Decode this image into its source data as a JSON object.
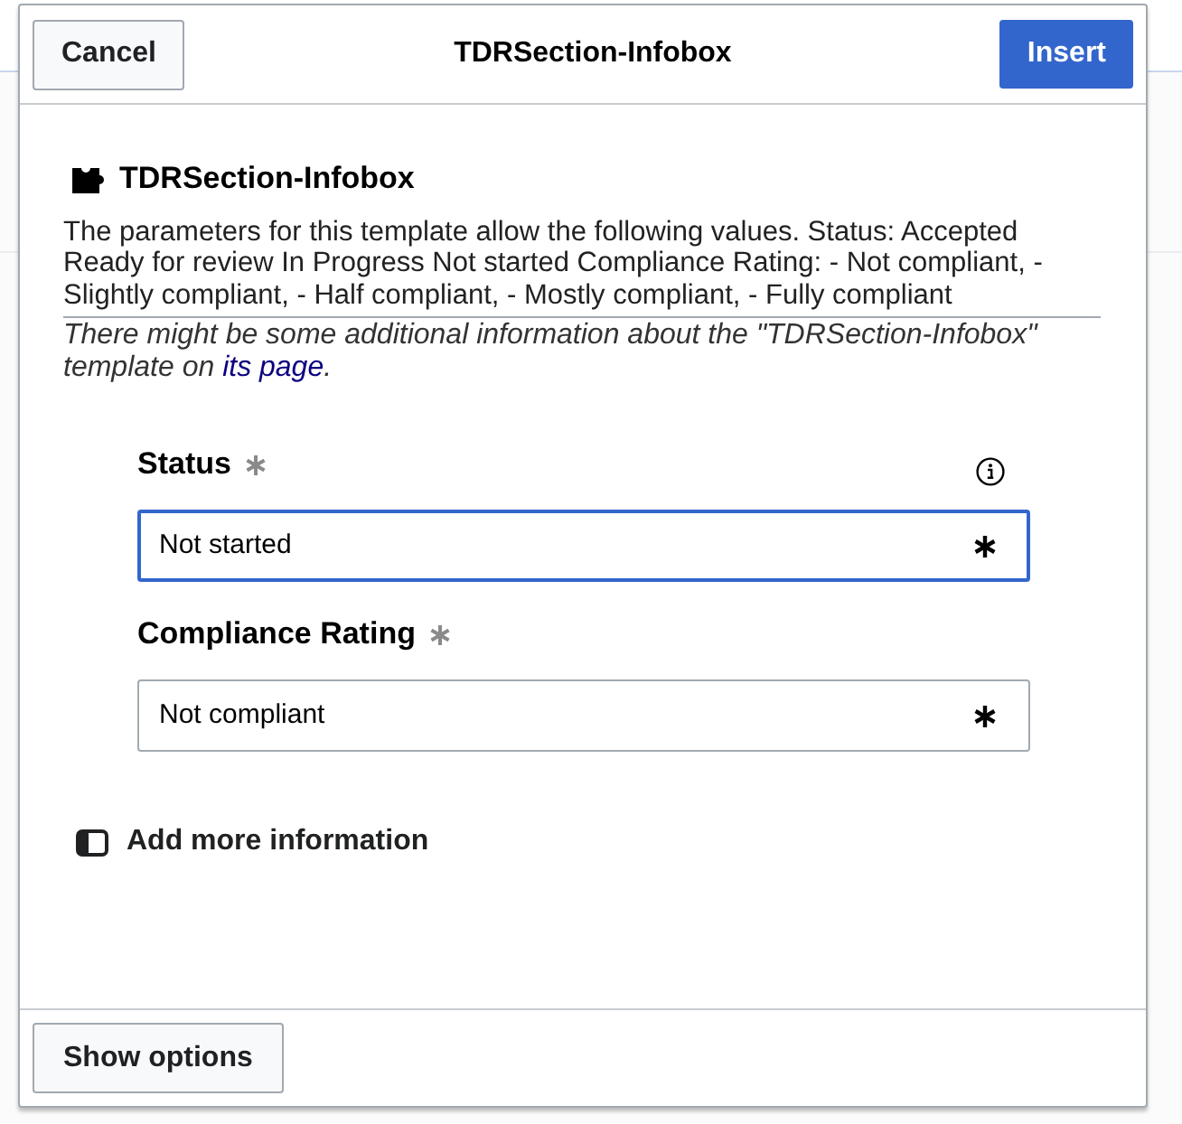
{
  "dialog": {
    "cancel_button": "Cancel",
    "title": "TDRSection-Infobox",
    "insert_button": "Insert"
  },
  "template": {
    "name": "TDRSection-Infobox",
    "description": "The parameters for this template allow the following values. Status: Accepted Ready for review In Progress Not started Compliance Rating: - Not compliant, - Slightly compliant, - Half compliant, - Mostly compliant, - Fully compliant",
    "note": "There might be some additional information about the \"TDRSection-Infobox\" template on ",
    "note_link": "its page",
    "note_end": "."
  },
  "parameters": [
    {
      "label": "Status",
      "required": true,
      "info": true,
      "value": "Not started",
      "focused": true
    },
    {
      "label": "Compliance Rating",
      "required": true,
      "info": false,
      "value": "Not compliant",
      "focused": false
    }
  ],
  "add_more": {
    "label": "Add more information"
  },
  "footer": {
    "show_options_button": "Show options"
  }
}
